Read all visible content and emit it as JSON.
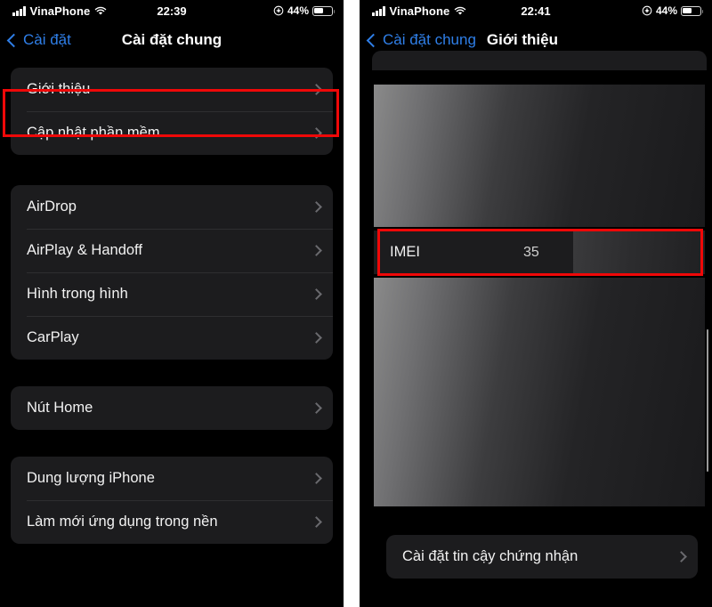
{
  "left_phone": {
    "status_bar": {
      "carrier": "VinaPhone",
      "time": "22:39",
      "battery_percent": "44%",
      "signal_icon": "cellular-bars-icon",
      "wifi_icon": "wifi-icon",
      "location_icon": "location-services-icon",
      "battery_icon": "battery-icon"
    },
    "nav": {
      "back_label": "Cài đặt",
      "title": "Cài đặt chung",
      "back_icon": "chevron-left-icon"
    },
    "groups": [
      {
        "rows": [
          {
            "label": "Giới thiệu",
            "accessory": "chevron-right-icon",
            "highlighted": true
          },
          {
            "label": "Cập nhật phần mềm",
            "accessory": "chevron-right-icon",
            "highlighted": false
          }
        ]
      },
      {
        "rows": [
          {
            "label": "AirDrop",
            "accessory": "chevron-right-icon",
            "highlighted": false
          },
          {
            "label": "AirPlay & Handoff",
            "accessory": "chevron-right-icon",
            "highlighted": false
          },
          {
            "label": "Hình trong hình",
            "accessory": "chevron-right-icon",
            "highlighted": false
          },
          {
            "label": "CarPlay",
            "accessory": "chevron-right-icon",
            "highlighted": false
          }
        ]
      },
      {
        "rows": [
          {
            "label": "Nút Home",
            "accessory": "chevron-right-icon",
            "highlighted": false
          }
        ]
      },
      {
        "rows": [
          {
            "label": "Dung lượng iPhone",
            "accessory": "chevron-right-icon",
            "highlighted": false
          },
          {
            "label": "Làm mới ứng dụng trong nền",
            "accessory": "chevron-right-icon",
            "highlighted": false
          }
        ]
      }
    ]
  },
  "right_phone": {
    "status_bar": {
      "carrier": "VinaPhone",
      "time": "22:41",
      "battery_percent": "44%",
      "signal_icon": "cellular-bars-icon",
      "wifi_icon": "wifi-icon",
      "location_icon": "location-services-icon",
      "battery_icon": "battery-icon"
    },
    "nav": {
      "back_label": "Cài đặt chung",
      "title": "Giới thiệu",
      "back_icon": "chevron-left-icon"
    },
    "imei_row": {
      "label": "IMEI",
      "value": "35",
      "highlighted": true
    },
    "bottom_row": {
      "label": "Cài đặt tin cậy chứng nhận",
      "accessory": "chevron-right-icon"
    }
  },
  "annotation": {
    "highlight_color": "#ef0808",
    "accent_color": "#2f7fe8",
    "row_background": "#1c1c1e",
    "screen_background": "#000000"
  }
}
